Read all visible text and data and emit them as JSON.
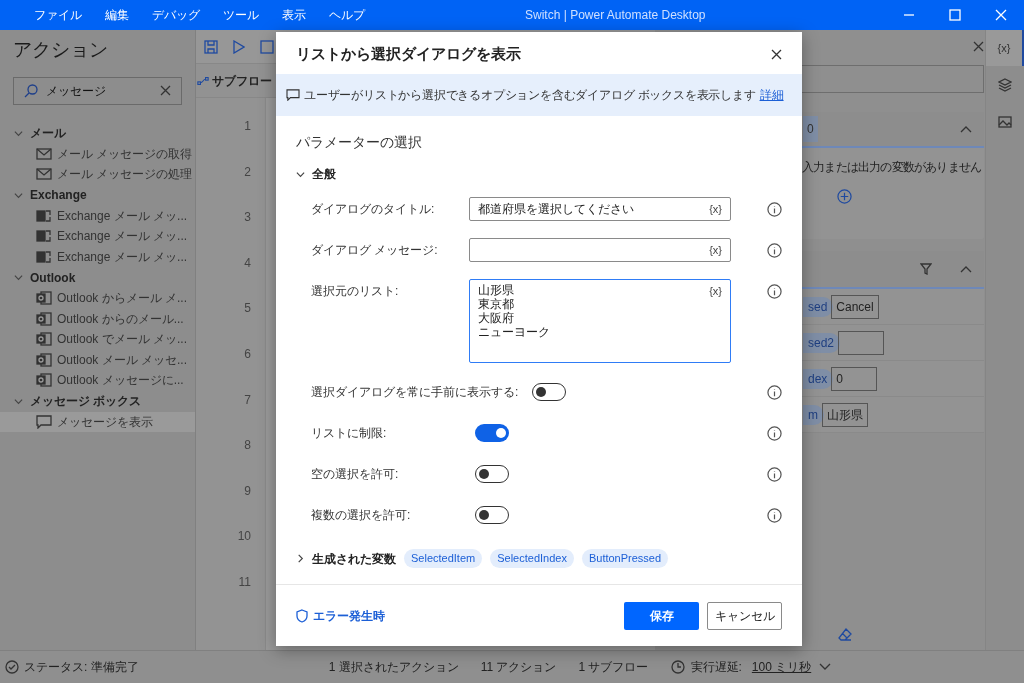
{
  "window": {
    "title": "Switch | Power Automate Desktop"
  },
  "menu": [
    "ファイル",
    "編集",
    "デバッグ",
    "ツール",
    "表示",
    "ヘルプ"
  ],
  "actions_panel": {
    "title": "アクション",
    "search": {
      "value": "メッセージ"
    },
    "tree": [
      {
        "label": "メール",
        "expanded": true,
        "children": [
          {
            "label": "メール メッセージの取得",
            "kind": "mail",
            "selected": false
          },
          {
            "label": "メール メッセージの処理",
            "kind": "mail",
            "selected": false
          }
        ]
      },
      {
        "label": "Exchange",
        "expanded": true,
        "children": [
          {
            "label": "Exchange メール メッ...",
            "kind": "exchange",
            "selected": false
          },
          {
            "label": "Exchange メール メッ...",
            "kind": "exchange",
            "selected": false
          },
          {
            "label": "Exchange メール メッ...",
            "kind": "exchange",
            "selected": false
          }
        ]
      },
      {
        "label": "Outlook",
        "expanded": true,
        "children": [
          {
            "label": "Outlook からメール メ...",
            "kind": "outlook",
            "selected": false
          },
          {
            "label": "Outlook からのメール...",
            "kind": "outlook",
            "selected": false
          },
          {
            "label": "Outlook でメール メッ...",
            "kind": "outlook",
            "selected": false
          },
          {
            "label": "Outlook メール メッセ...",
            "kind": "outlook",
            "selected": false
          },
          {
            "label": "Outlook メッセージに...",
            "kind": "outlook",
            "selected": false
          }
        ]
      },
      {
        "label": "メッセージ ボックス",
        "expanded": true,
        "children": [
          {
            "label": "メッセージを表示",
            "kind": "message",
            "selected": true
          }
        ]
      }
    ]
  },
  "flow_editor": {
    "tab": "サブフロー",
    "line_numbers": [
      "1",
      "2",
      "3",
      "4",
      "5",
      "6",
      "7",
      "8",
      "9",
      "10",
      "11"
    ]
  },
  "variables_panel": {
    "io_count": "0",
    "empty_message": "入力または出力の変数がありません",
    "flow_variables": [
      {
        "name": "sed",
        "value": "Cancel"
      },
      {
        "name": "sed2"
      },
      {
        "name": "dex",
        "value": "0"
      },
      {
        "name": "m",
        "value": "山形県"
      }
    ]
  },
  "side_strip": {
    "variables_label": "{x}",
    "variables_selected": true
  },
  "dialog": {
    "title": "リストから選択ダイアログを表示",
    "description": "ユーザーがリストから選択できるオプションを含むダイアログ ボックスを表示します",
    "details_link": "詳細",
    "section_title": "パラメーターの選択",
    "group": {
      "label": "全般",
      "expanded": true
    },
    "fields": [
      {
        "kind": "text",
        "label": "ダイアログのタイトル:",
        "value": "都道府県を選択してください",
        "var_button": "{x}"
      },
      {
        "kind": "text",
        "label": "ダイアログ メッセージ:",
        "var_button": "{x}"
      },
      {
        "kind": "list",
        "label": "選択元のリスト:",
        "lines": [
          "山形県",
          "東京都",
          "大阪府",
          "ニューヨーク"
        ],
        "var_button": "{x}",
        "focused": true
      },
      {
        "kind": "toggle",
        "label": "選択ダイアログを常に手前に表示する:",
        "on": false
      },
      {
        "kind": "toggle",
        "label": "リストに制限:",
        "on": true
      },
      {
        "kind": "toggle",
        "label": "空の選択を許可:",
        "on": false
      },
      {
        "kind": "toggle",
        "label": "複数の選択を許可:",
        "on": false
      }
    ],
    "generated": {
      "label": "生成された変数",
      "expanded": false,
      "variables": [
        "SelectedItem",
        "SelectedIndex",
        "ButtonPressed"
      ]
    },
    "error_link": "エラー発生時",
    "save": "保存",
    "cancel": "キャンセル"
  },
  "status_bar": {
    "status": "ステータス: 準備完了",
    "selected_actions": "1 選択されたアクション",
    "actions": "11 アクション",
    "subflows": "1 サブフロー",
    "delay_label": "実行遅延:",
    "delay_value": "100 ミリ秒"
  }
}
